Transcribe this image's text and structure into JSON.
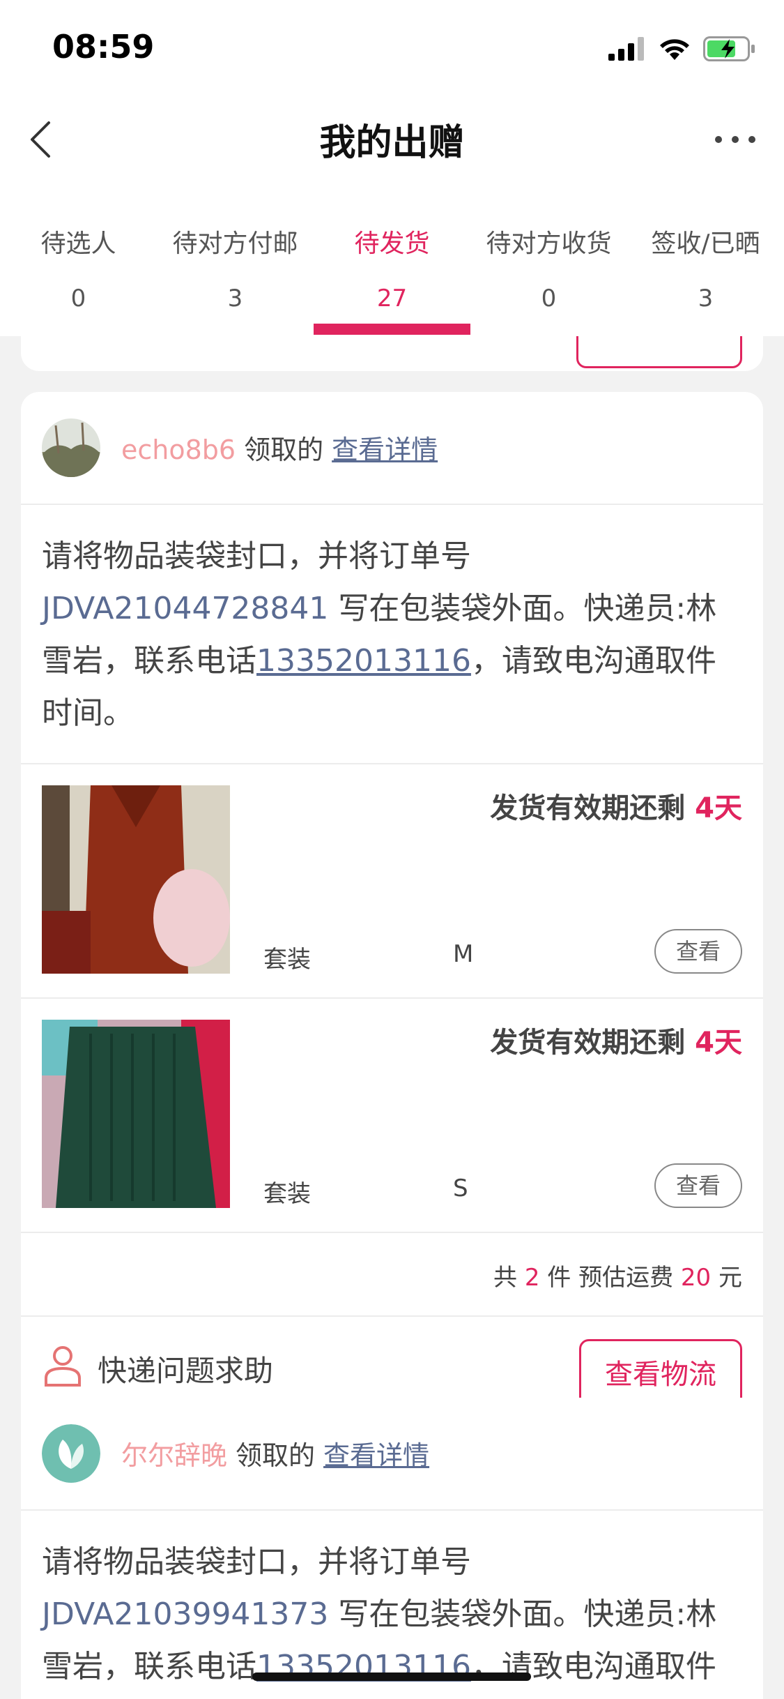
{
  "status_bar": {
    "time": "08:59"
  },
  "nav": {
    "title": "我的出赠"
  },
  "tabs": [
    {
      "label": "待选人",
      "count": "0"
    },
    {
      "label": "待对方付邮",
      "count": "3"
    },
    {
      "label": "待发货",
      "count": "27"
    },
    {
      "label": "待对方收货",
      "count": "0"
    },
    {
      "label": "签收/已晒",
      "count": "3"
    }
  ],
  "active_tab_index": 2,
  "colors": {
    "accent": "#e0245e",
    "link": "#5a6b92",
    "username": "#f29da0"
  },
  "cards": [
    {
      "username": "echo8b6",
      "claimed_text": "领取的",
      "detail_link": "查看详情",
      "instruction": {
        "prefix": "请将物品装袋封口，并将订单号 ",
        "order_no": "JDVA21044728841",
        "middle": " 写在包装袋外面。快递员:林雪岩，联系电话",
        "phone": "13352013116",
        "suffix": "，请致电沟通取件时间。"
      },
      "items": [
        {
          "validity_label": "发货有效期还剩 ",
          "days": "4天",
          "category": "套装",
          "size": "M",
          "view_label": "查看"
        },
        {
          "validity_label": "发货有效期还剩 ",
          "days": "4天",
          "category": "套装",
          "size": "S",
          "view_label": "查看"
        }
      ],
      "summary": {
        "pre": "共 ",
        "count": "2",
        "mid": " 件 预估运费 ",
        "fee": "20",
        "post": " 元"
      },
      "help_text": "快递问题求助",
      "logistics_button": "查看物流"
    },
    {
      "username": "尔尔辞晚",
      "claimed_text": "领取的",
      "detail_link": "查看详情",
      "instruction": {
        "prefix": "请将物品装袋封口，并将订单号 ",
        "order_no": "JDVA21039941373",
        "middle": " 写在包装袋外面。快递员:林雪岩，联系电话",
        "phone": "13352013116",
        "suffix": "，请致电沟通取件时间。"
      }
    }
  ]
}
